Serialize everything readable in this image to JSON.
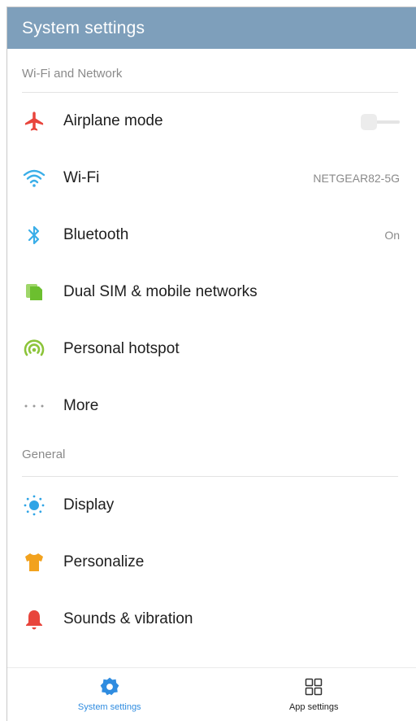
{
  "app_bar": {
    "title": "System settings"
  },
  "sections": [
    {
      "header": "Wi-Fi and Network",
      "items": [
        {
          "label": "Airplane mode",
          "icon": "airplane-icon",
          "icon_color": "#e8453c",
          "toggle": "off"
        },
        {
          "label": "Wi-Fi",
          "icon": "wifi-icon",
          "icon_color": "#3aaee8",
          "value": "NETGEAR82-5G"
        },
        {
          "label": "Bluetooth",
          "icon": "bluetooth-icon",
          "icon_color": "#3aaee8",
          "value": "On"
        },
        {
          "label": "Dual SIM & mobile networks",
          "icon": "sim-card-icon",
          "icon_color": "#6cbf2f"
        },
        {
          "label": "Personal hotspot",
          "icon": "hotspot-icon",
          "icon_color": "#8cc43a"
        },
        {
          "label": "More",
          "icon": "more-dots-icon",
          "icon_color": "#9a9a9a"
        }
      ]
    },
    {
      "header": "General",
      "items": [
        {
          "label": "Display",
          "icon": "brightness-icon",
          "icon_color": "#2fa4e6"
        },
        {
          "label": "Personalize",
          "icon": "tshirt-icon",
          "icon_color": "#f2a21e"
        },
        {
          "label": "Sounds & vibration",
          "icon": "bell-icon",
          "icon_color": "#e8453c"
        }
      ]
    }
  ],
  "bottom_nav": [
    {
      "label": "System settings",
      "icon": "gear-icon",
      "active": true,
      "color": "#2f8ce0"
    },
    {
      "label": "App settings",
      "icon": "grid-icon",
      "active": false,
      "color": "#333333"
    }
  ]
}
